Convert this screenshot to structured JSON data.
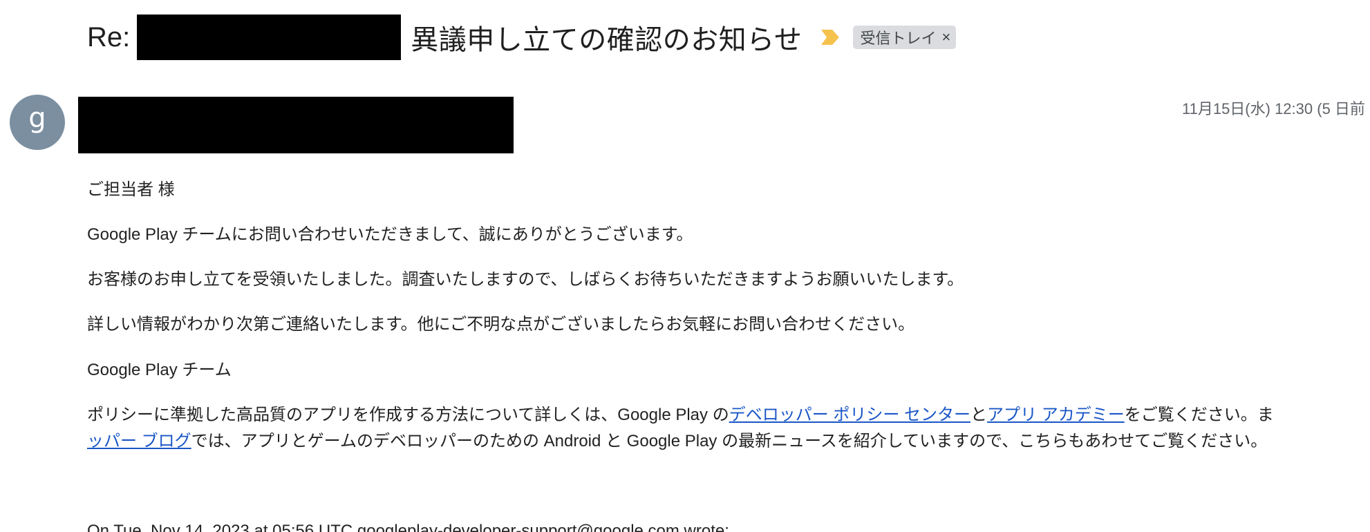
{
  "subject": {
    "prefix": "Re:",
    "text": "異議申し立ての確認のお知らせ",
    "label": "受信トレイ",
    "label_close": "×"
  },
  "icons": {
    "importance": "importance-marker-icon",
    "label_close": "close-icon"
  },
  "sender": {
    "avatar_letter": "g",
    "timestamp": "11月15日(水) 12:30 (5 日前"
  },
  "body": {
    "greeting": "ご担当者 様",
    "p1": "Google Play チームにお問い合わせいただきまして、誠にありがとうございます。",
    "p2": "お客様のお申し立てを受領いたしました。調査いたしますので、しばらくお待ちいただきますようお願いいたします。",
    "p3": "詳しい情報がわかり次第ご連絡いたします。他にご不明な点がございましたらお気軽にお問い合わせください。",
    "team": "Google Play チーム",
    "policy_pre": "ポリシーに準拠した高品質のアプリを作成する方法について詳しくは、Google Play の",
    "policy_link1": "デベロッパー ポリシー センター",
    "policy_mid": "と",
    "policy_link2": "アプリ アカデミー",
    "policy_post": "をご覧ください。ま",
    "policy_link3": "ッパー ブログ",
    "policy_line2": "では、アプリとゲームのデベロッパーのための Android と Google Play の最新ニュースを紹介していますので、こちらもあわせてご覧ください。",
    "quote_header": "On Tue, Nov 14, 2023 at 05:56 UTC googleplay-developer-support@google.com wrote:"
  },
  "colors": {
    "importance": "#f4c24d",
    "link": "#1a56c6",
    "avatar": "#7b8fa0",
    "chip": "#dadce0"
  }
}
